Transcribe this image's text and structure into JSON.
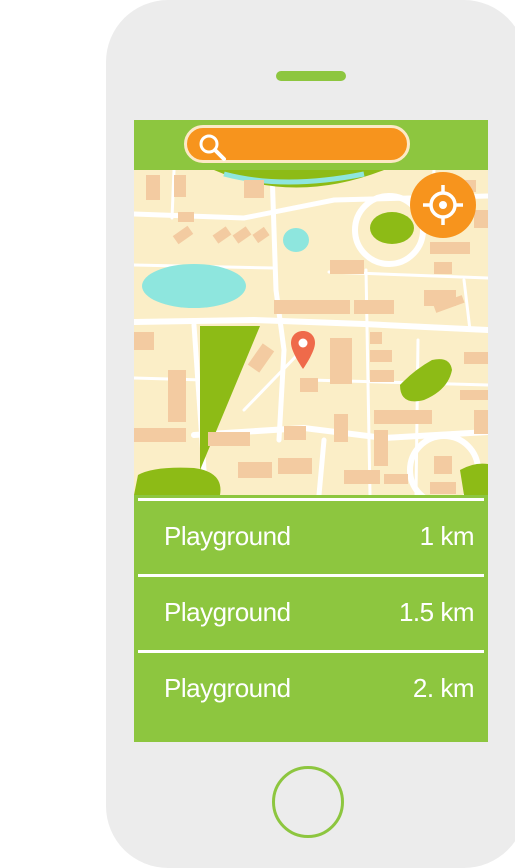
{
  "colors": {
    "accent_green": "#8dc63f",
    "accent_orange": "#f7941d",
    "map_land": "#fbeec7",
    "water": "#8ee6de",
    "building": "#f3cba1",
    "park": "#8dbb16"
  },
  "device": {
    "speaker_icon": "speaker-slot",
    "home_icon": "home-circle"
  },
  "search": {
    "value": "",
    "placeholder": "",
    "icon": "magnifier-icon"
  },
  "map": {
    "locate_icon": "crosshair-icon",
    "pin_icon": "location-pin-icon"
  },
  "places": [
    {
      "name": "Playground",
      "distance": "1 km"
    },
    {
      "name": "Playground",
      "distance": "1.5 km"
    },
    {
      "name": "Playground",
      "distance": "2. km"
    }
  ]
}
